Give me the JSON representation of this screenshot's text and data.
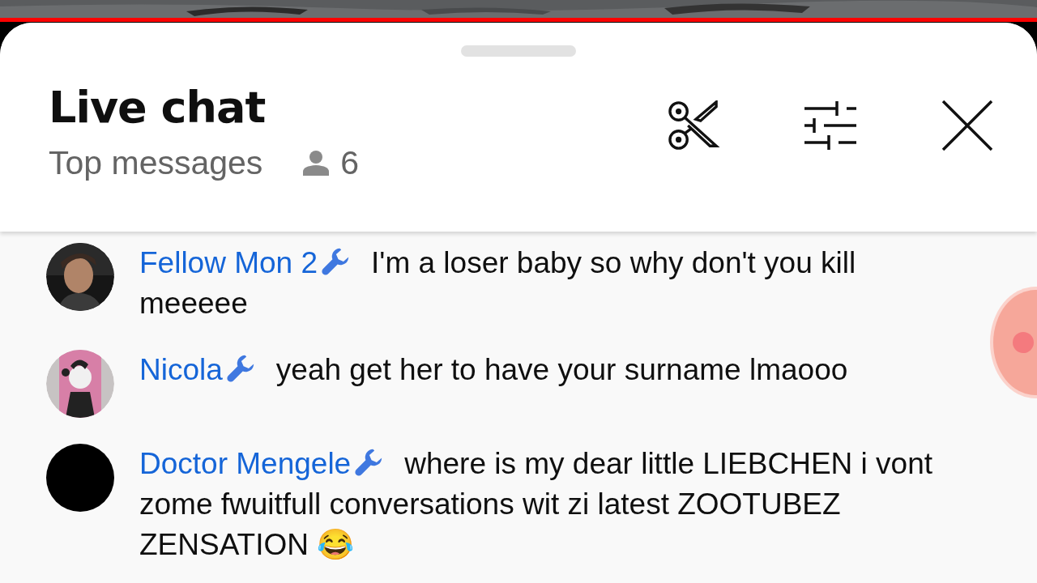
{
  "player": {
    "progress": {
      "level": 1
    }
  },
  "header": {
    "title": "Live chat",
    "mode": "Top messages",
    "viewers": "6"
  },
  "messages": [
    {
      "author": "Fellow Mon 2",
      "moderator": true,
      "kind": "picture",
      "text": "I'm a loser baby so why don't you kill meeeee"
    },
    {
      "author": "Nicola",
      "moderator": true,
      "kind": "picture",
      "text": "yeah get her to have your surname lmaooo"
    },
    {
      "author": "Doctor Mengele",
      "moderator": true,
      "kind": "blank",
      "text": "where is my dear little LIEBCHEN i vont zome fwuitfull conversations wit zi latest ZOOTUBEZ ZENSATION 😂"
    }
  ]
}
